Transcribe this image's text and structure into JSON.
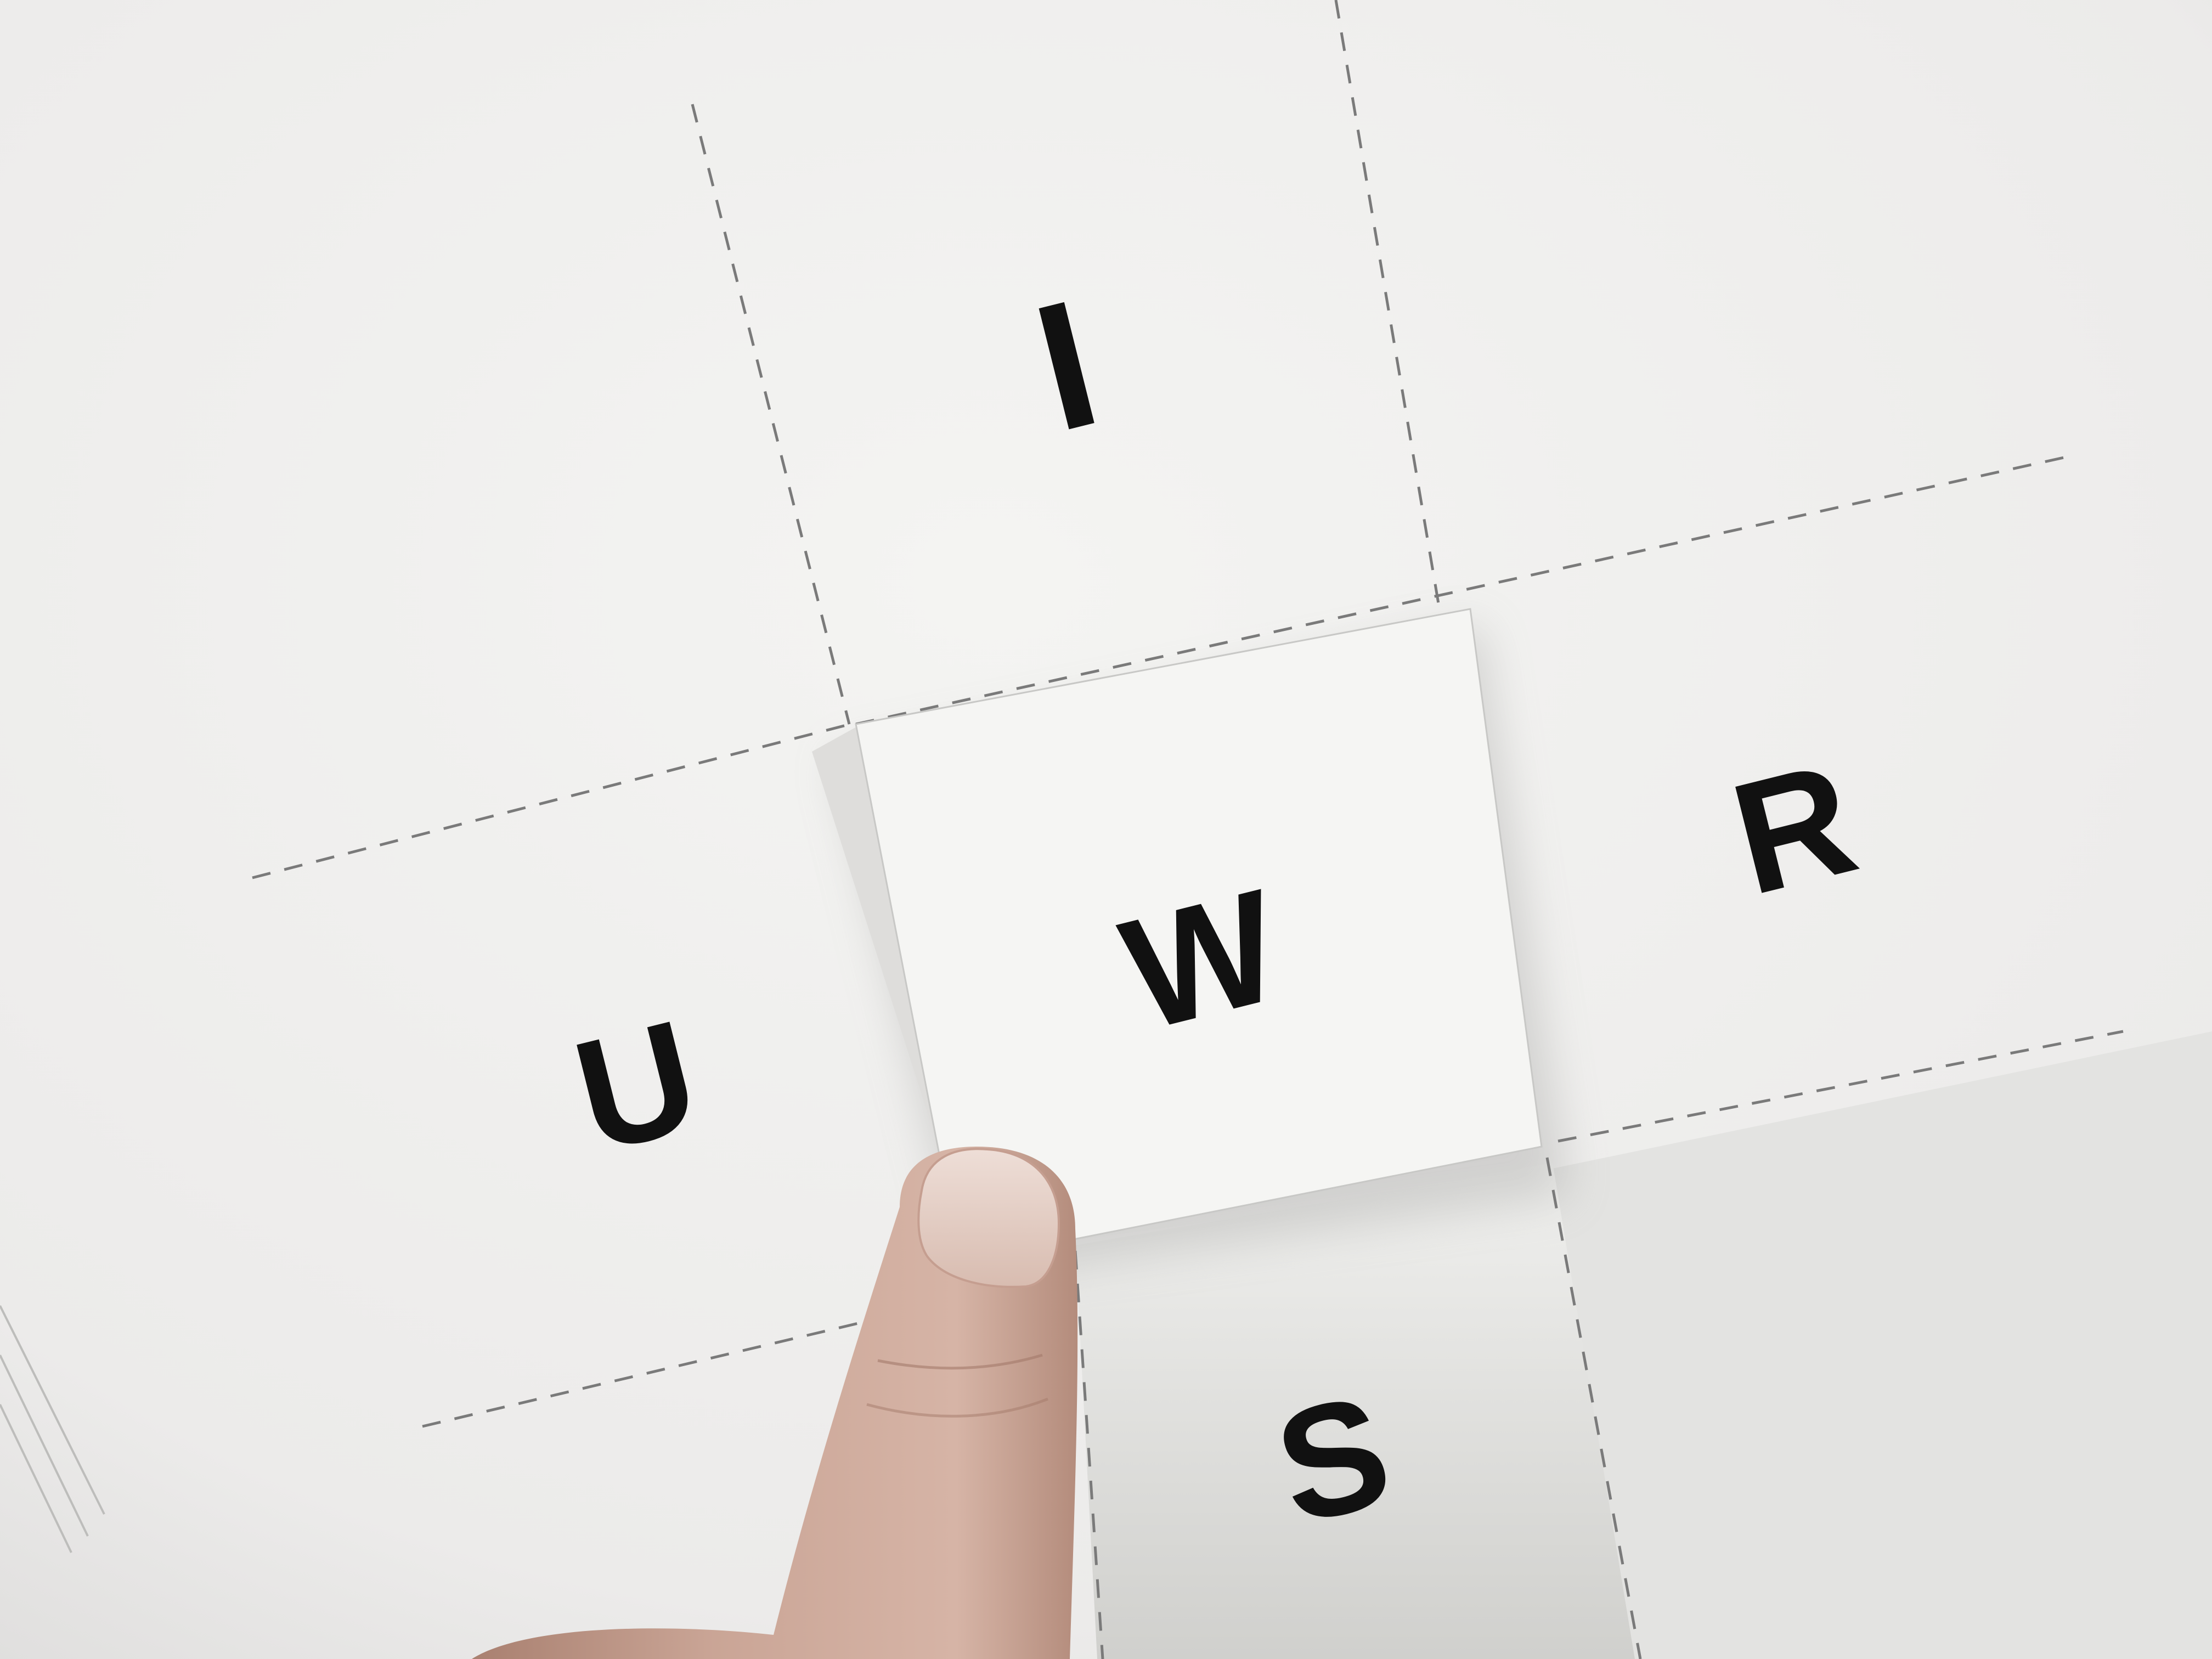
{
  "letters": {
    "top": "I",
    "left": "U",
    "center": "W",
    "right": "R",
    "bottom": "S"
  },
  "colors": {
    "paper": "#f3f3f1",
    "paper_shadow": "#d9d9d7",
    "ink": "#111111",
    "dash": "#7a7a7a",
    "skin": "#c9a497",
    "nail": "#e6d3cb"
  }
}
